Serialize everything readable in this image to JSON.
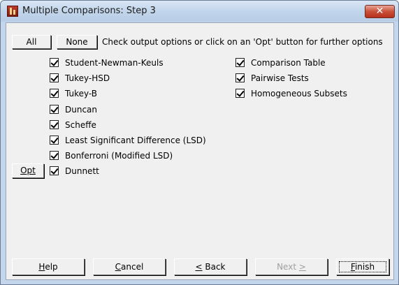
{
  "window": {
    "title": "Multiple Comparisons: Step 3",
    "close_label": "✕"
  },
  "header": {
    "all_label": "All",
    "none_label": "None",
    "instructions": "Check output options or click on an 'Opt' button for further options"
  },
  "tests": [
    {
      "label": "Student-Newman-Keuls",
      "checked": true
    },
    {
      "label": "Tukey-HSD",
      "checked": true
    },
    {
      "label": "Tukey-B",
      "checked": true
    },
    {
      "label": "Duncan",
      "checked": true
    },
    {
      "label": "Scheffe",
      "checked": true
    },
    {
      "label": "Least Significant Difference (LSD)",
      "checked": true
    },
    {
      "label": "Bonferroni (Modified LSD)",
      "checked": true
    },
    {
      "label": "Dunnett",
      "checked": true
    }
  ],
  "opt_label": "Opt",
  "outputs": [
    {
      "label": "Comparison Table",
      "checked": true
    },
    {
      "label": "Pairwise Tests",
      "checked": true
    },
    {
      "label": "Homogeneous Subsets",
      "checked": true
    }
  ],
  "footer": {
    "help_accel": "H",
    "help_rest": "elp",
    "cancel_accel": "C",
    "cancel_rest": "ancel",
    "back_accel": "<",
    "back_rest": " Back",
    "next_text": "Next ",
    "next_accel": ">",
    "finish_accel": "F",
    "finish_rest": "inish"
  },
  "colors": {
    "frame": "#c3d6ec",
    "client": "#f0f0f0",
    "close": "#c9503a"
  }
}
